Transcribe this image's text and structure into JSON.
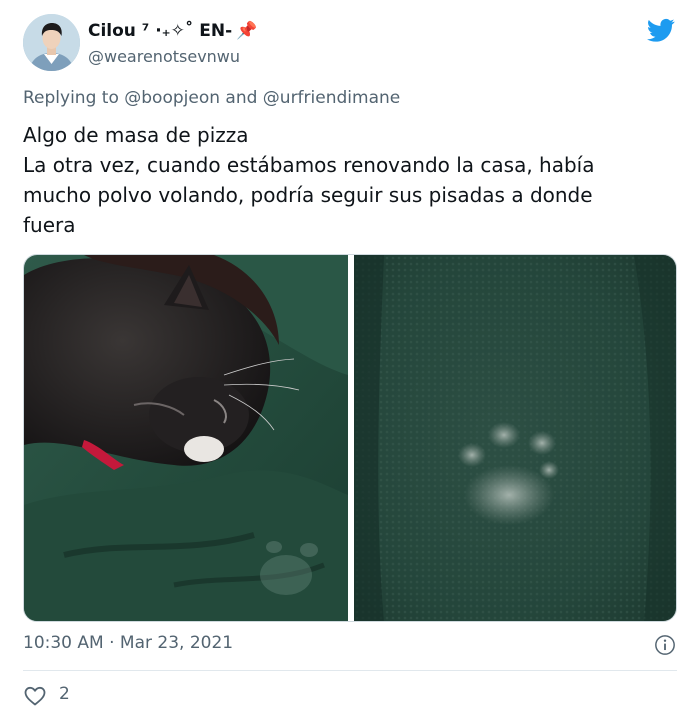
{
  "author": {
    "display_name": "Cilou ⁷ ·₊✧˚ EN-",
    "pin_emoji": "📌",
    "username": "@wearenotsevnwu"
  },
  "reply": {
    "prefix": "Replying to",
    "mention_1": "@boopjeon",
    "conjunction": "and",
    "mention_2": "@urfriendimane"
  },
  "tweet_text": [
    "Algo de masa de pizza",
    "La otra vez, cuando estábamos  renovando la casa, había",
    "mucho polvo volando, podría seguir sus pisadas a donde",
    "fuera"
  ],
  "timestamp": "10:30 AM · Mar 23, 2021",
  "likes": "2",
  "icons": {
    "logo": "twitter-bird-icon",
    "info": "info-icon",
    "like": "heart-icon"
  },
  "colors": {
    "twitter_blue": "#1d9bf0",
    "secondary_text": "#536471",
    "pin": "#e0245e"
  }
}
